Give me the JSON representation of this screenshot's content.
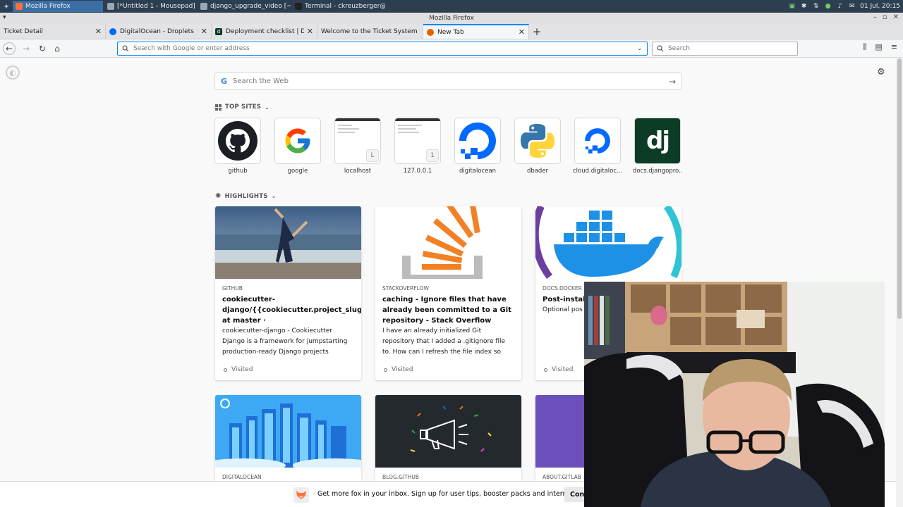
{
  "taskbar": {
    "tasks": [
      {
        "label": "Mozilla Firefox",
        "color": "#ff7139",
        "active": true
      },
      {
        "label": "[*Untitled 1 - Mousepad]",
        "color": "#9aa7b4",
        "active": false
      },
      {
        "label": "django_upgrade_video [~/pri...",
        "color": "#9aa7b4",
        "active": false
      },
      {
        "label": "Terminal - ckreuzberger@ck...",
        "color": "#222222",
        "active": false
      }
    ],
    "clock": "01 Jul, 20:15"
  },
  "window": {
    "title": "Mozilla Firefox"
  },
  "tabs": [
    {
      "label": "Ticket Detail",
      "favicon_color": "",
      "selected": false
    },
    {
      "label": "DigitalOcean - Droplets",
      "favicon_color": "#0069ff",
      "selected": false
    },
    {
      "label": "Deployment checklist | Djang",
      "favicon_color": "#0c3c26",
      "selected": false
    },
    {
      "label": "Welcome to the Ticket System",
      "favicon_color": "",
      "selected": false
    },
    {
      "label": "New Tab",
      "favicon_color": "#e66000",
      "selected": true
    }
  ],
  "navbar": {
    "url_placeholder": "Search with Google or enter address",
    "search_placeholder": "Search"
  },
  "newtab": {
    "web_search_placeholder": "Search the Web",
    "top_sites_heading": "TOP SITES",
    "highlights_heading": "HIGHLIGHTS",
    "top_sites": [
      {
        "name": "github",
        "kind": "github-logo"
      },
      {
        "name": "google",
        "kind": "google-logo"
      },
      {
        "name": "localhost",
        "kind": "screenshot",
        "badge": "L"
      },
      {
        "name": "127.0.0.1",
        "kind": "screenshot",
        "badge": "1"
      },
      {
        "name": "digitalocean",
        "kind": "digitalocean-logo"
      },
      {
        "name": "dbader",
        "kind": "python-logo"
      },
      {
        "name": "cloud.digitaloc...",
        "kind": "digitalocean-logo-small"
      },
      {
        "name": "docs.djangopro...",
        "kind": "django-logo"
      }
    ],
    "highlights": [
      {
        "source": "GITHUB",
        "title": "cookiecutter-django/{{cookiecutter.project_slug}} at master ·",
        "description": "cookiecutter-django - Cookiecutter Django is a framework for jumpstarting production-ready Django projects",
        "status": "Visited"
      },
      {
        "source": "STACKOVERFLOW",
        "title": "caching - Ignore files that have already been committed to a Git repository - Stack Overflow",
        "description": "I have an already initialized Git repository that I added a .gitignore file to. How can I refresh the file index so",
        "status": "Visited"
      },
      {
        "source": "DOCS.DOCKER",
        "title": "Post-instal Docker Doc",
        "description": "Optional pos Linux",
        "status": "Visited"
      }
    ],
    "highlights_row2": [
      {
        "source": "DIGITALOCEAN"
      },
      {
        "source": "BLOG.GITHUB"
      },
      {
        "source": "ABOUT.GITLAB"
      }
    ]
  },
  "snippet": {
    "text": "Get more fox in your inbox. Sign up for user tips, booster packs and internet intel.",
    "button": "Conti"
  }
}
